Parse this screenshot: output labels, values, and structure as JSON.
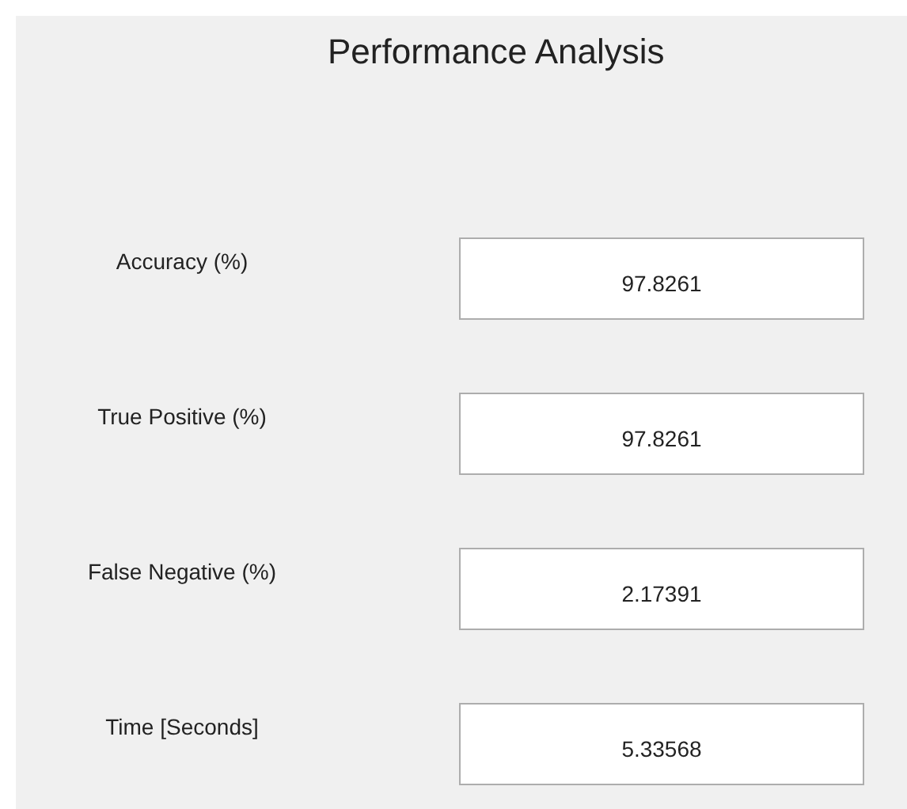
{
  "title": "Performance Analysis",
  "fields": [
    {
      "label": "Accuracy (%)",
      "value": "97.8261"
    },
    {
      "label": "True Positive (%)",
      "value": "97.8261"
    },
    {
      "label": "False Negative (%)",
      "value": "2.17391"
    },
    {
      "label": "Time [Seconds]",
      "value": "5.33568"
    }
  ]
}
